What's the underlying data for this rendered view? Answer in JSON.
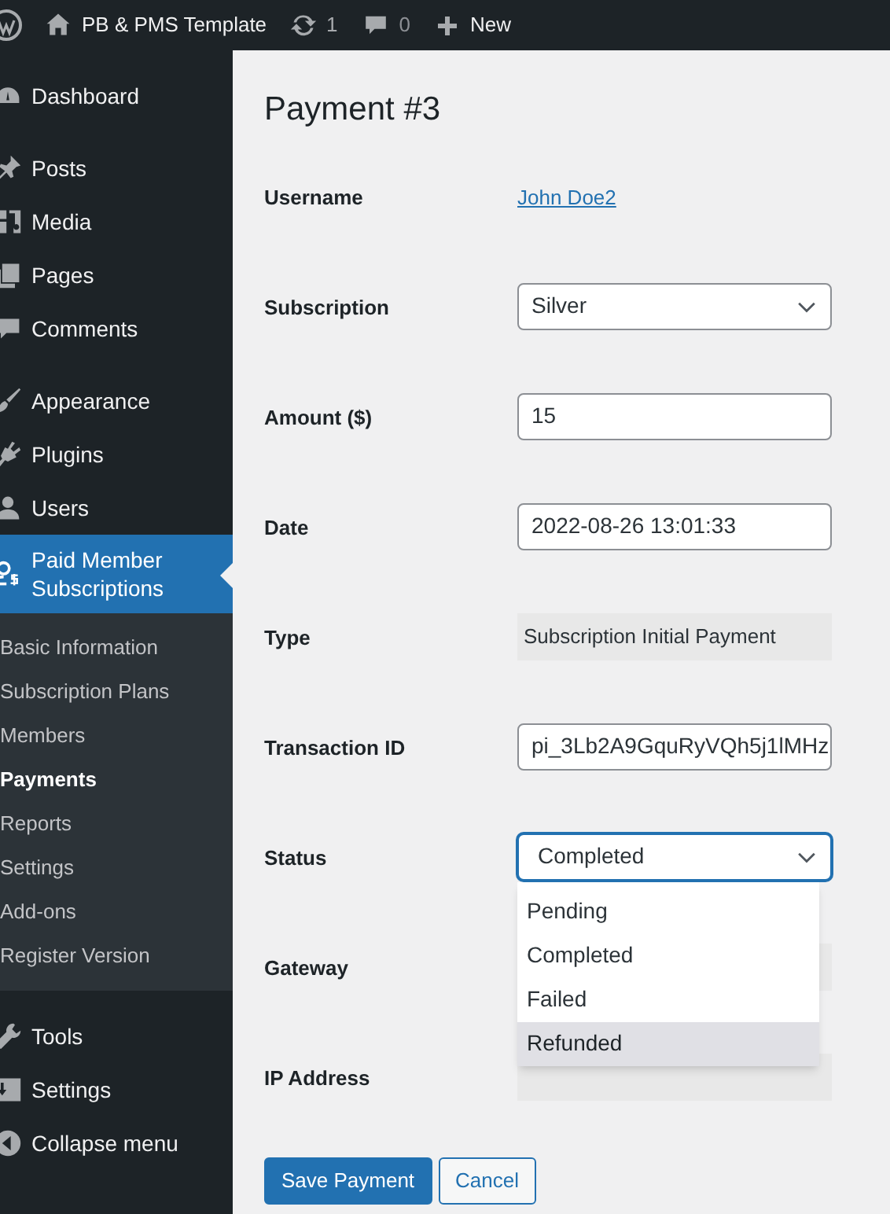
{
  "admin_bar": {
    "site_name": "PB & PMS Template",
    "updates_count": "1",
    "comments_count": "0",
    "new_label": "New"
  },
  "sidebar": {
    "groups": [
      [
        {
          "label": "Dashboard",
          "selected": false
        }
      ],
      [
        {
          "label": "Posts",
          "selected": false
        },
        {
          "label": "Media",
          "selected": false
        },
        {
          "label": "Pages",
          "selected": false
        },
        {
          "label": "Comments",
          "selected": false
        }
      ],
      [
        {
          "label": "Appearance",
          "selected": false
        },
        {
          "label": "Plugins",
          "selected": false
        },
        {
          "label": "Users",
          "selected": false
        },
        {
          "label": "Paid Member Subscriptions",
          "selected": true,
          "submenu": [
            {
              "label": "Basic Information",
              "selected": false
            },
            {
              "label": "Subscription Plans",
              "selected": false
            },
            {
              "label": "Members",
              "selected": false
            },
            {
              "label": "Payments",
              "selected": true
            },
            {
              "label": "Reports",
              "selected": false
            },
            {
              "label": "Settings",
              "selected": false
            },
            {
              "label": "Add-ons",
              "selected": false
            },
            {
              "label": "Register Version",
              "selected": false
            }
          ]
        }
      ],
      [
        {
          "label": "Tools",
          "selected": false
        },
        {
          "label": "Settings",
          "selected": false
        },
        {
          "label": "Collapse menu",
          "selected": false
        }
      ]
    ]
  },
  "page_title": "Payment #3",
  "fields": [
    {
      "kind": "link",
      "label": "Username",
      "value": "John Doe2"
    },
    {
      "kind": "select",
      "label": "Subscription",
      "value": "Silver"
    },
    {
      "kind": "input",
      "label": "Amount ($)",
      "value": "15"
    },
    {
      "kind": "input",
      "label": "Date",
      "value": "2022-08-26 13:01:33"
    },
    {
      "kind": "readonly",
      "label": "Type",
      "value": "Subscription Initial Payment"
    },
    {
      "kind": "input",
      "label": "Transaction ID",
      "value": "pi_3Lb2A9GquRyVQh5j1lMHz"
    },
    {
      "kind": "select",
      "label": "Status",
      "value": "Completed",
      "focused": true,
      "options": [
        {
          "label": "Pending",
          "highlighted": false
        },
        {
          "label": "Completed",
          "highlighted": false
        },
        {
          "label": "Failed",
          "highlighted": false
        },
        {
          "label": "Refunded",
          "highlighted": true
        }
      ]
    },
    {
      "kind": "readonly",
      "label": "Gateway"
    },
    {
      "kind": "readonly",
      "label": "IP Address"
    }
  ],
  "buttons": [
    {
      "label": "Save Payment",
      "kind": "primary"
    },
    {
      "label": "Cancel",
      "kind": "secondary"
    }
  ]
}
